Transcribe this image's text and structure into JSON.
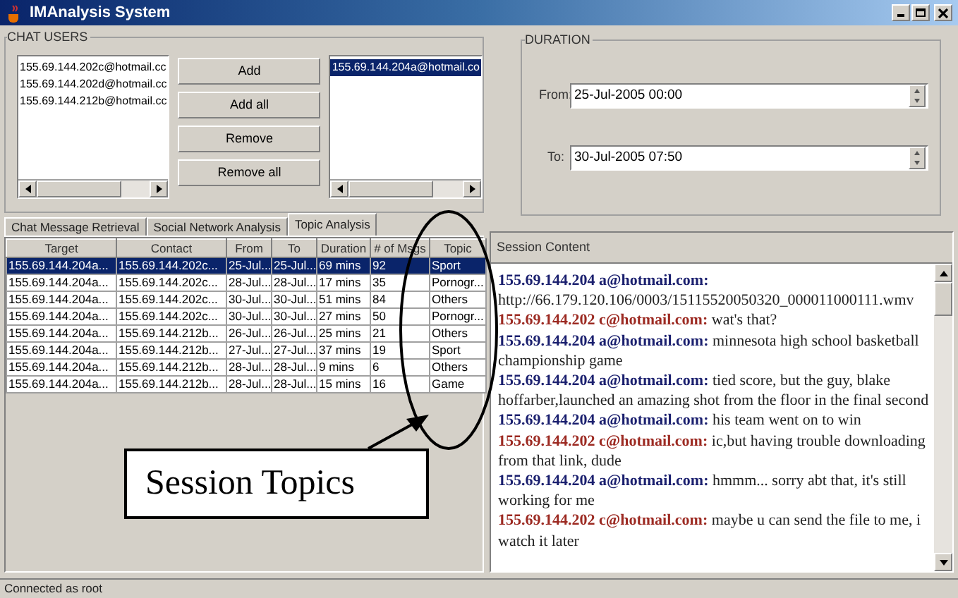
{
  "window": {
    "title": "IMAnalysis System"
  },
  "chat_users": {
    "title": "CHAT USERS",
    "available": [
      {
        "label": "155.69.144.202c@hotmail.cc",
        "selected": false
      },
      {
        "label": "155.69.144.202d@hotmail.cc",
        "selected": false
      },
      {
        "label": "155.69.144.212b@hotmail.cc",
        "selected": false
      }
    ],
    "buttons": [
      "Add",
      "Add all",
      "Remove",
      "Remove all"
    ],
    "chosen": [
      {
        "label": "155.69.144.204a@hotmail.co",
        "selected": true
      }
    ]
  },
  "duration": {
    "title": "DURATION",
    "from_label": "From:",
    "from": "25-Jul-2005 00:00",
    "to_label": "To:",
    "to": "30-Jul-2005 07:50"
  },
  "tabs": [
    {
      "label": "Chat Message Retrieval",
      "selected": false
    },
    {
      "label": "Social Network Analysis",
      "selected": false
    },
    {
      "label": "Topic Analysis",
      "selected": true
    }
  ],
  "table": {
    "columns": [
      "Target",
      "Contact",
      "From",
      "To",
      "Duration",
      "# of Msgs",
      "Topic"
    ],
    "rows": [
      {
        "cells": [
          "155.69.144.204a...",
          "155.69.144.202c...",
          "25-Jul...",
          "25-Jul...",
          "69 mins",
          "92",
          "Sport"
        ],
        "selected": true
      },
      {
        "cells": [
          "155.69.144.204a...",
          "155.69.144.202c...",
          "28-Jul...",
          "28-Jul...",
          "17 mins",
          "35",
          "Pornogr..."
        ],
        "selected": false
      },
      {
        "cells": [
          "155.69.144.204a...",
          "155.69.144.202c...",
          "30-Jul...",
          "30-Jul...",
          "51 mins",
          "84",
          "Others"
        ],
        "selected": false
      },
      {
        "cells": [
          "155.69.144.204a...",
          "155.69.144.202c...",
          "30-Jul...",
          "30-Jul...",
          "27 mins",
          "50",
          "Pornogr..."
        ],
        "selected": false
      },
      {
        "cells": [
          "155.69.144.204a...",
          "155.69.144.212b...",
          "26-Jul...",
          "26-Jul...",
          "25 mins",
          "21",
          "Others"
        ],
        "selected": false
      },
      {
        "cells": [
          "155.69.144.204a...",
          "155.69.144.212b...",
          "27-Jul...",
          "27-Jul...",
          "37 mins",
          "19",
          "Sport"
        ],
        "selected": false
      },
      {
        "cells": [
          "155.69.144.204a...",
          "155.69.144.212b...",
          "28-Jul...",
          "28-Jul...",
          "9 mins",
          "6",
          "Others"
        ],
        "selected": false
      },
      {
        "cells": [
          "155.69.144.204a...",
          "155.69.144.212b...",
          "28-Jul...",
          "28-Jul...",
          "15 mins",
          "16",
          "Game"
        ],
        "selected": false
      }
    ]
  },
  "session": {
    "title": "Session Content",
    "messages": [
      {
        "sender": "155.69.144.204 a@hotmail.com:",
        "color": "#1a1f6e",
        "text": "http://66.179.120.106/0003/15115520050320_000011000111.wmv"
      },
      {
        "sender": "155.69.144.202 c@hotmail.com:",
        "color": "#9c2a22",
        "text": "wat's that?"
      },
      {
        "sender": "155.69.144.204 a@hotmail.com:",
        "color": "#1a1f6e",
        "text": "minnesota high school basketball championship game"
      },
      {
        "sender": "155.69.144.204 a@hotmail.com:",
        "color": "#1a1f6e",
        "text": "tied score, but the guy, blake hoffarber,launched an amazing shot from the floor in the final second"
      },
      {
        "sender": "155.69.144.204 a@hotmail.com:",
        "color": "#1a1f6e",
        "text": "his team went on to win"
      },
      {
        "sender": "155.69.144.202 c@hotmail.com:",
        "color": "#9c2a22",
        "text": "ic,but having trouble downloading from that link, dude"
      },
      {
        "sender": "155.69.144.204 a@hotmail.com:",
        "color": "#1a1f6e",
        "text": "hmmm... sorry abt that, it's still working for me"
      },
      {
        "sender": "155.69.144.202 c@hotmail.com:",
        "color": "#9c2a22",
        "text": "maybe u can send the file to me, i watch it later"
      }
    ]
  },
  "annotation": {
    "label": "Session Topics"
  },
  "status_bar": "Connected as root"
}
